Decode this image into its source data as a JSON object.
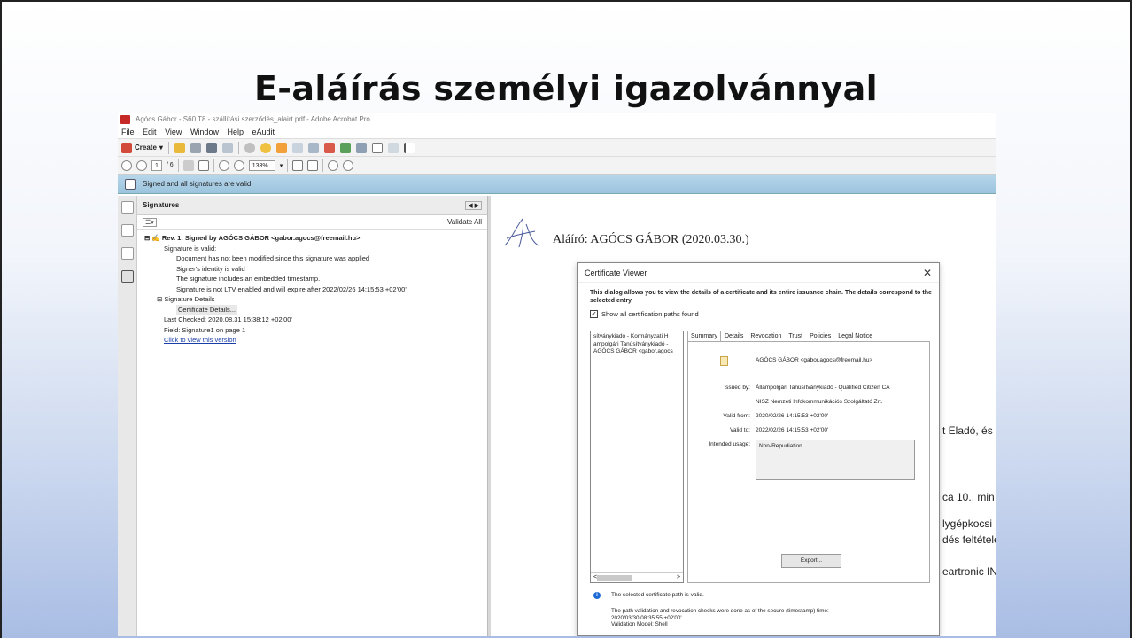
{
  "slide": {
    "title": "E-aláírás személyi igazolvánnyal"
  },
  "window": {
    "title": "Agócs Gábor - S60 T8 - szállítási szerződés_alairt.pdf - Adobe Acrobat Pro"
  },
  "menu": [
    "File",
    "Edit",
    "View",
    "Window",
    "Help",
    "eAudit"
  ],
  "toolbar": {
    "create_label": "Create",
    "page_current": "1",
    "page_total": "/ 6",
    "zoom": "133%"
  },
  "message_bar": {
    "text": "Signed and all signatures are valid."
  },
  "signatures_panel": {
    "title": "Signatures",
    "validate_all": "Validate All",
    "revision": "Rev. 1: Signed by AGÓCS GÁBOR <gabor.agocs@freemail.hu>",
    "valid_label": "Signature is valid:",
    "details": [
      "Document has not been modified since this signature was applied",
      "Signer's identity is valid",
      "The signature includes an embedded timestamp.",
      "Signature is not LTV enabled and will expire after 2022/02/26 14:15:53 +02'00'"
    ],
    "sig_details_label": "Signature Details",
    "cert_details_label": "Certificate Details...",
    "last_checked": "Last Checked: 2020.08.31 15:38:12 +02'00'",
    "field": "Field: Signature1 on page 1",
    "view_version": "Click to view this version"
  },
  "document": {
    "signer_line": "Aláíró: AGÓCS GÁBOR (2020.03.30.)",
    "fragments": [
      "t Eladó, és",
      "ca 10., min",
      "lygépkocsi",
      "dés feltétele",
      "eartronic IN"
    ]
  },
  "cert_viewer": {
    "title": "Certificate Viewer",
    "close": "✕",
    "description": "This dialog allows you to view the details of a certificate and its entire issuance chain. The details correspond to the selected entry.",
    "show_all_paths": "Show all certification paths found",
    "path": [
      "sítványkiadó - Kormányzati H",
      "ampolgári Tanúsítványkiadó -",
      "AGÓCS GÁBOR <gabor.agocs"
    ],
    "scroll_left": "<",
    "scroll_right": ">",
    "tabs": [
      "Summary",
      "Details",
      "Revocation",
      "Trust",
      "Policies",
      "Legal Notice"
    ],
    "subject": "AGÓCS GÁBOR <gabor.agocs@freemail.hu>",
    "issued_by_label": "Issued by:",
    "issued_by_1": "Állampolgári Tanúsítványkiadó - Qualified Citizen CA",
    "issued_by_2": "NISZ Nemzeti Infokommunikációs Szolgáltató Zrt.",
    "valid_from_label": "Valid from:",
    "valid_from": "2020/02/26 14:15:53 +02'00'",
    "valid_to_label": "Valid to:",
    "valid_to": "2022/02/26 14:15:53 +02'00'",
    "usage_label": "Intended usage:",
    "usage": "Non-Repudiation",
    "export": "Export...",
    "status": "The selected certificate path is valid.",
    "status_detail_1": "The path validation and revocation checks were done as of the secure (timestamp) time:",
    "status_detail_2": "2020/03/30 08:35:55 +02'00'",
    "status_detail_3": "Validation Model: Shell"
  }
}
